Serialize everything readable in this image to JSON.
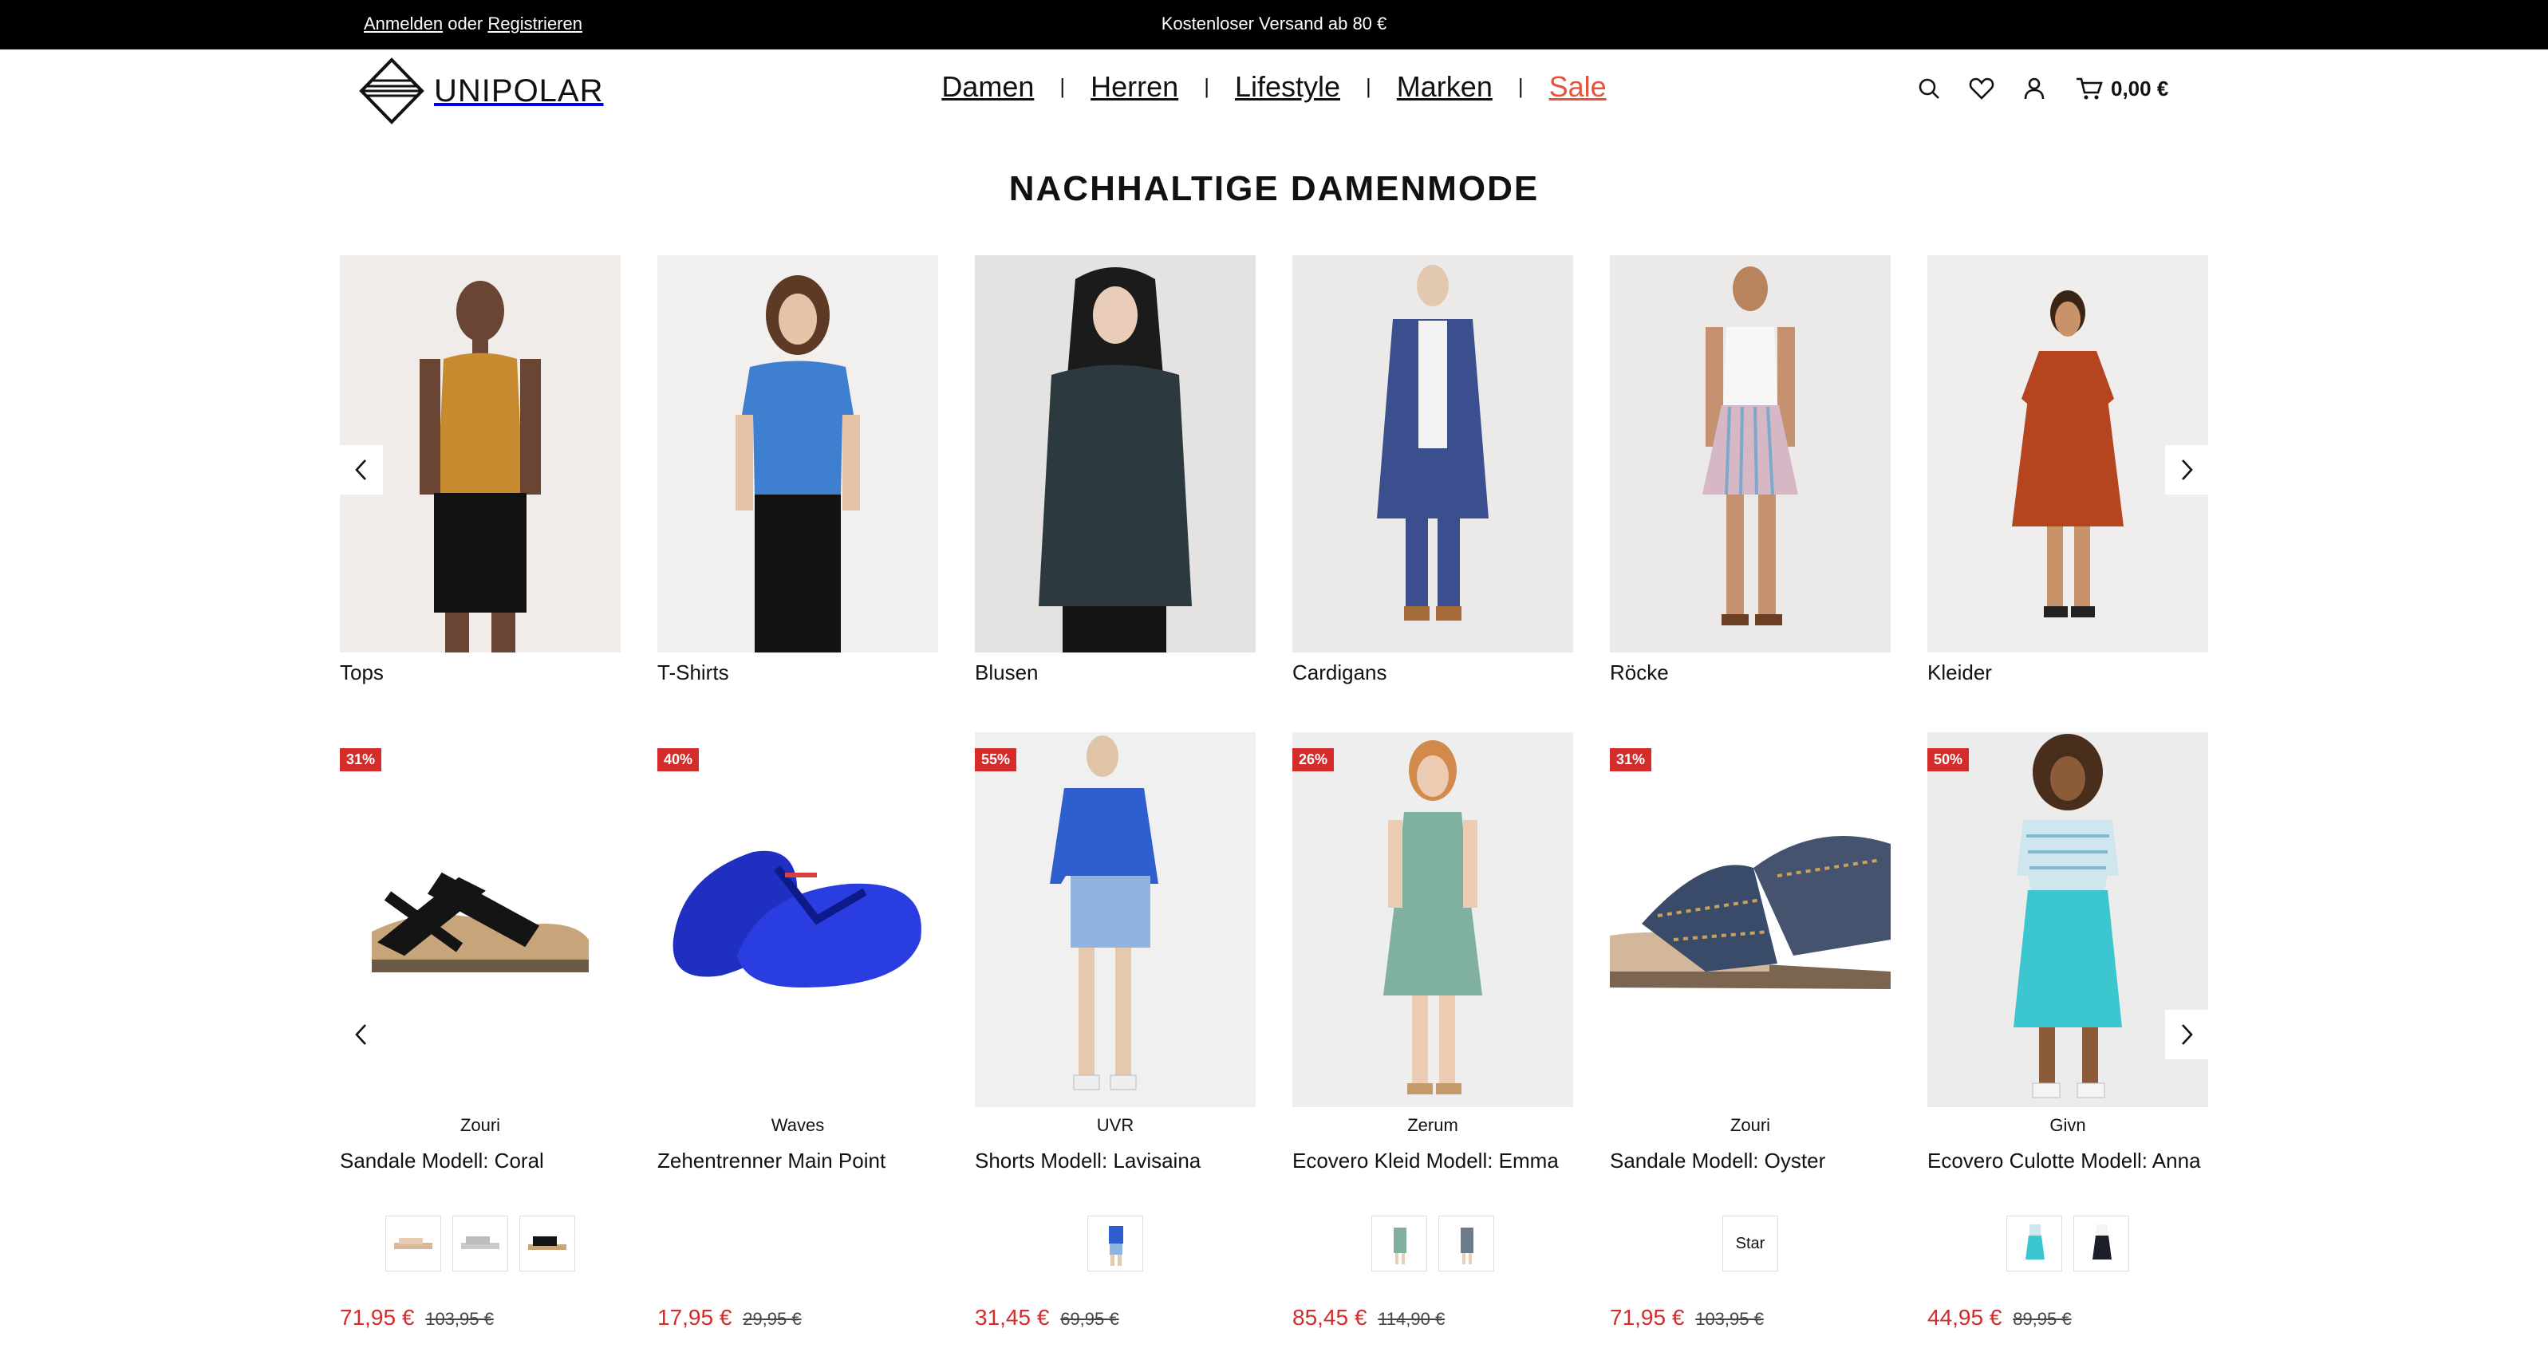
{
  "topbar": {
    "login": "Anmelden",
    "or": "oder",
    "register": "Registrieren",
    "promo": "Kostenloser Versand ab 80 €"
  },
  "brand": {
    "name": "UNIPOLAR"
  },
  "nav": {
    "items": [
      "Damen",
      "Herren",
      "Lifestyle",
      "Marken",
      "Sale"
    ]
  },
  "header": {
    "cart_total": "0,00 €"
  },
  "page": {
    "title": "NACHHALTIGE DAMENMODE"
  },
  "categories": [
    {
      "label": "Tops"
    },
    {
      "label": "T-Shirts"
    },
    {
      "label": "Blusen"
    },
    {
      "label": "Cardigans"
    },
    {
      "label": "Röcke"
    },
    {
      "label": "Kleider"
    }
  ],
  "products": [
    {
      "badge": "31%",
      "brand": "Zouri",
      "name": "Sandale Modell: Coral",
      "price": "71,95 €",
      "old_price": "103,95 €"
    },
    {
      "badge": "40%",
      "brand": "Waves",
      "name": "Zehentrenner Main Point",
      "price": "17,95 €",
      "old_price": "29,95 €"
    },
    {
      "badge": "55%",
      "brand": "UVR",
      "name": "Shorts Modell: Lavisaina",
      "price": "31,45 €",
      "old_price": "69,95 €"
    },
    {
      "badge": "26%",
      "brand": "Zerum",
      "name": "Ecovero Kleid Modell: Emma",
      "price": "85,45 €",
      "old_price": "114,90 €"
    },
    {
      "badge": "31%",
      "brand": "Zouri",
      "name": "Sandale Modell: Oyster",
      "price": "71,95 €",
      "old_price": "103,95 €",
      "swatch_text": "Star"
    },
    {
      "badge": "50%",
      "brand": "Givn",
      "name": "Ecovero Culotte Modell: Anna",
      "price": "44,95 €",
      "old_price": "89,95 €"
    }
  ],
  "colors": {
    "sale_red": "#d42b2b",
    "nav_sale": "#e8523a",
    "topbar_bg": "#000000"
  }
}
